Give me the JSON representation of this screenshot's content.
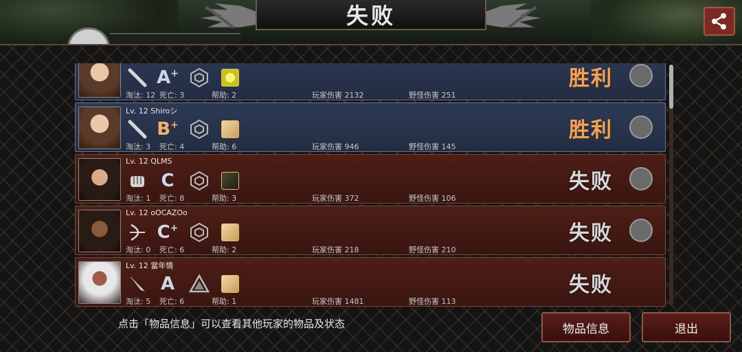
{
  "title": "失败",
  "share_icon": "share-icon",
  "players": [
    {
      "name": "",
      "weapon_icon": "bat-icon",
      "grade": "A",
      "grade_plus": "+",
      "rank_icon": "hexagon-rank-icon",
      "item_icon": "yellow-gem-icon",
      "kills": "淘汰: 12",
      "deaths": "死亡: 3",
      "assists": "帮助: 2",
      "player_damage": "玩家伤害 2132",
      "monster_damage": "野怪伤害 251",
      "result": "胜利",
      "outcome": "win"
    },
    {
      "name": "Lv. 12 Shiroシ",
      "weapon_icon": "bat-icon",
      "grade": "B",
      "grade_plus": "+",
      "rank_icon": "hexagon-rank-icon",
      "item_icon": "beige-item-icon",
      "kills": "淘汰: 3",
      "deaths": "死亡: 4",
      "assists": "帮助: 6",
      "player_damage": "玩家伤害 946",
      "monster_damage": "野怪伤害 145",
      "result": "胜利",
      "outcome": "win"
    },
    {
      "name": "Lv. 12 QLMS",
      "weapon_icon": "fist-icon",
      "grade": "C",
      "grade_plus": "",
      "rank_icon": "hexagon-rank-icon",
      "item_icon": "dark-item-icon",
      "kills": "淘汰: 1",
      "deaths": "死亡: 8",
      "assists": "帮助: 3",
      "player_damage": "玩家伤害 372",
      "monster_damage": "野怪伤害 106",
      "result": "失败",
      "outcome": "lose"
    },
    {
      "name": "Lv. 12 oOCAZOo",
      "weapon_icon": "bow-icon",
      "grade": "C",
      "grade_plus": "+",
      "rank_icon": "hexagon-rank-icon",
      "item_icon": "beige-item-icon",
      "kills": "淘汰: 0",
      "deaths": "死亡: 6",
      "assists": "帮助: 2",
      "player_damage": "玩家伤害 218",
      "monster_damage": "野怪伤害 210",
      "result": "失败",
      "outcome": "lose"
    },
    {
      "name": "Lv. 12 當年情",
      "weapon_icon": "knife-icon",
      "grade": "A",
      "grade_plus": "",
      "rank_icon": "triangle-rank-icon",
      "item_icon": "beige-item-icon",
      "kills": "淘汰: 5",
      "deaths": "死亡: 6",
      "assists": "帮助: 1",
      "player_damage": "玩家伤害 1481",
      "monster_damage": "野怪伤害 113",
      "result": "失败",
      "outcome": "lose"
    }
  ],
  "hint": "点击「物品信息」可以查看其他玩家的物品及状态",
  "buttons": {
    "items": "物品信息",
    "exit": "退出"
  },
  "colors": {
    "win_row": "#2e3a55",
    "lose_row": "#4d1f17",
    "win_text": "#f0a45a",
    "button": "#5a1d18"
  }
}
